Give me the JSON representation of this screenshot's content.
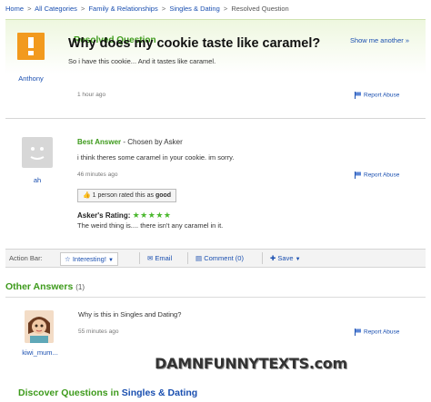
{
  "breadcrumb": {
    "items": [
      "Home",
      "All Categories",
      "Family & Relationships",
      "Singles & Dating"
    ],
    "current": "Resolved Question",
    "separator": ">"
  },
  "question": {
    "status_label": "Resolved Question",
    "show_me_another": "Show me another »",
    "title": "Why does my cookie taste like caramel?",
    "body": "So i have this cookie... And it tastes like caramel.",
    "time": "1 hour ago",
    "report": "Report Abuse",
    "asker": "Anthony",
    "avatar_icon": "exclamation-avatar-icon"
  },
  "best_answer": {
    "label": "Best Answer",
    "chosen_by": " - Chosen by Asker",
    "body": "i think theres some caramel in your cookie. im sorry.",
    "time": "46 minutes ago",
    "report": "Report Abuse",
    "author": "ah",
    "rated_text": "1 person rated this as ",
    "rated_value": "good",
    "asker_rating_label": "Asker's Rating:",
    "stars": "★★★★★",
    "rating": 5,
    "rating_comment": "The weird thing is.... there isn't any caramel in it."
  },
  "action_bar": {
    "label": "Action Bar:",
    "interesting": "Interesting!",
    "email": "Email",
    "comment": "Comment (0)",
    "save": "Save"
  },
  "other_answers": {
    "heading": "Other Answers",
    "count": "(1)",
    "items": [
      {
        "author": "kiwi_mum...",
        "body": "Why is this in Singles and Dating?",
        "time": "55 minutes ago",
        "report": "Report Abuse"
      }
    ]
  },
  "watermark": "DAMNFUNNYTEXTS.com",
  "discover": {
    "prefix": "Discover Questions",
    "in": " in ",
    "category": "Singles & Dating"
  },
  "colors": {
    "accent_green": "#3d9a1b",
    "link_blue": "#1a4fb0",
    "avatar_orange": "#f29a1e",
    "star_green": "#4ab82d"
  }
}
